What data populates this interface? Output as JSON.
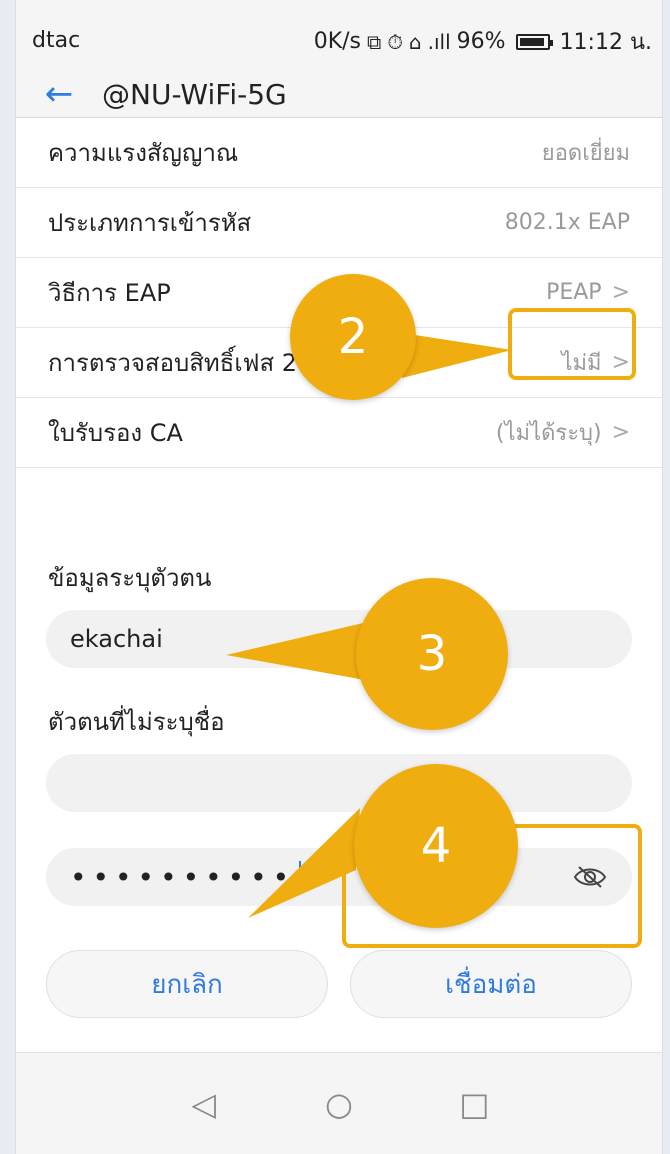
{
  "status": {
    "carrier": "dtac",
    "speed": "0K/s",
    "icons_text": "⧉ ⏱ ⌂",
    "signal": ".ıll",
    "battery": "96%",
    "time": "11:12 น."
  },
  "header": {
    "back_label": "←",
    "title": "@NU-WiFi-5G"
  },
  "rows": [
    {
      "label": "ความแรงสัญญาณ",
      "value": "ยอดเยี่ยม",
      "chevron": ""
    },
    {
      "label": "ประเภทการเข้ารหัส",
      "value": "802.1x EAP",
      "chevron": ""
    },
    {
      "label": "วิธีการ EAP",
      "value": "PEAP",
      "chevron": ">"
    },
    {
      "label": "การตรวจสอบสิทธิ์เฟส 2",
      "value": "ไม่มี",
      "chevron": ">"
    },
    {
      "label": "ใบรับรอง CA",
      "value": "(ไม่ได้ระบุ)",
      "chevron": ">"
    }
  ],
  "identity": {
    "label": "ข้อมูลระบุตัวตน",
    "value": "ekachai"
  },
  "anonymous": {
    "label": "ตัวตนที่ไม่ระบุชื่อ",
    "value": ""
  },
  "password": {
    "value": "••••••••••",
    "toggle_icon": "eye-off-icon"
  },
  "buttons": {
    "cancel": "ยกเลิก",
    "connect": "เชื่อมต่อ"
  },
  "callouts": {
    "two": "2",
    "three": "3",
    "four": "4"
  },
  "nav": {
    "back": "◁",
    "home": "○",
    "recent": "□"
  },
  "colors": {
    "accent": "#2f7bdf",
    "callout": "#f0ad10"
  }
}
